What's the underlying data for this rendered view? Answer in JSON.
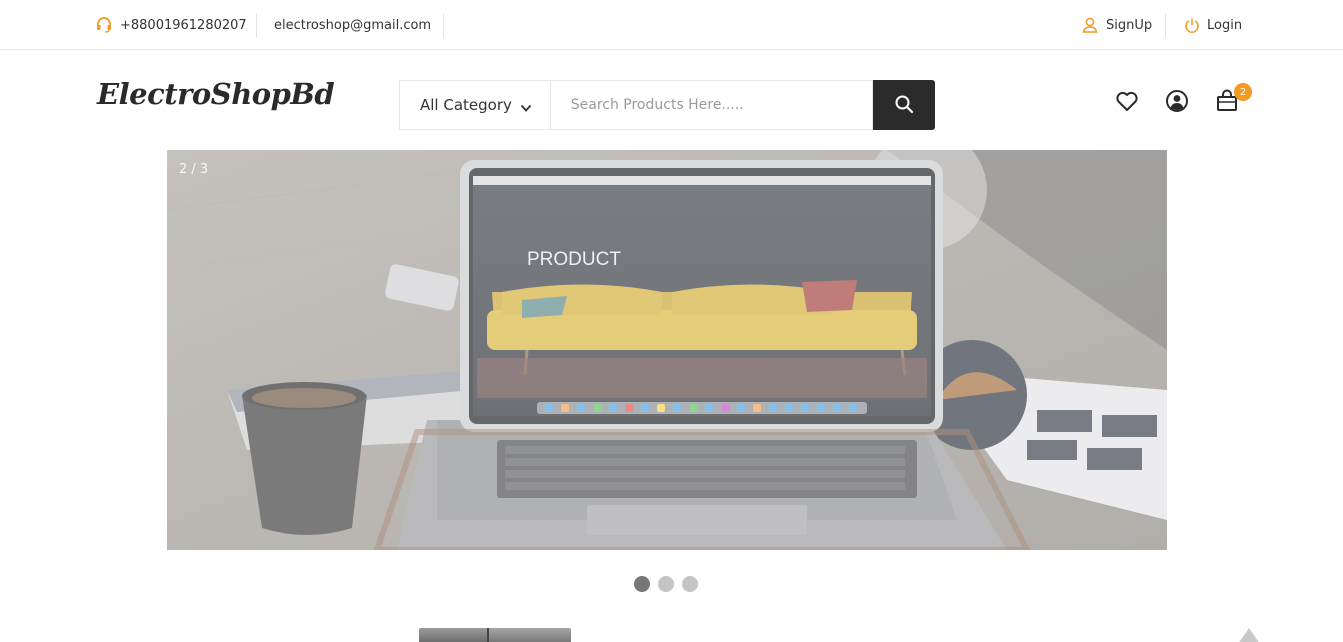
{
  "topbar": {
    "phone": "+88001961280207",
    "email": "electroshop@gmail.com",
    "signup_label": "SignUp",
    "login_label": "Login"
  },
  "header": {
    "logo": "ElectroShopBd",
    "category_label": "All Category",
    "search_placeholder": "Search Products Here.....",
    "cart_count": "2"
  },
  "slider": {
    "counter": "2 / 3",
    "screen_heading": "PRODUCT",
    "active_slide": 2,
    "total_slides": 3
  },
  "icons": {
    "phone": "headset-icon",
    "signup": "user-icon",
    "login": "power-icon",
    "category": "chevron-down-icon",
    "search": "search-icon",
    "wishlist": "heart-icon",
    "account": "user-circle-icon",
    "cart": "shopping-bag-icon"
  },
  "colors": {
    "accent": "#f39a22",
    "dark": "#2b2b2b"
  }
}
